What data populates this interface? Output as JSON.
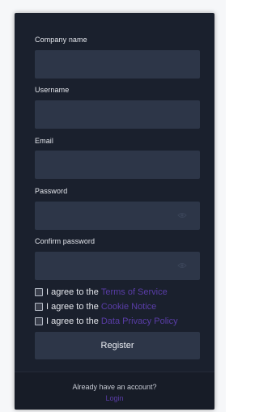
{
  "form": {
    "company_label": "Company name",
    "company_value": "",
    "username_label": "Username",
    "username_value": "",
    "email_label": "Email",
    "email_value": "",
    "password_label": "Password",
    "password_value": "",
    "confirm_label": "Confirm password",
    "confirm_value": "",
    "agreements": [
      {
        "prefix": "I agree to the",
        "link": "Terms of Service",
        "checked": false
      },
      {
        "prefix": "I agree to the",
        "link": "Cookie Notice",
        "checked": false
      },
      {
        "prefix": "I agree to the",
        "link": "Data Privacy Policy",
        "checked": false
      }
    ],
    "register_label": "Register"
  },
  "footer": {
    "text": "Already have an account?",
    "login_label": "Login"
  },
  "colors": {
    "card_bg": "#1a202d",
    "field_bg": "#2d3648",
    "link": "#5a3da8"
  },
  "icons": {
    "password_visibility": "eye-icon",
    "confirm_visibility": "eye-icon"
  }
}
